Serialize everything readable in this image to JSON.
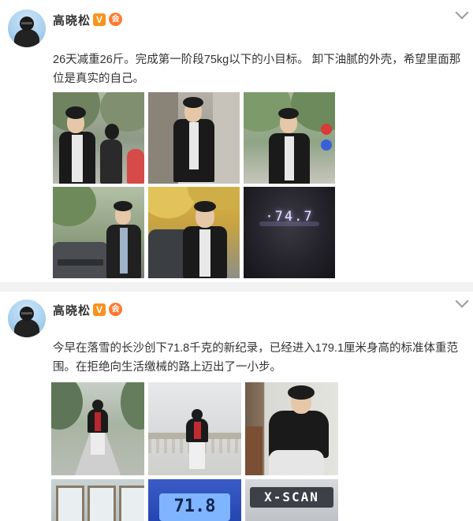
{
  "posts": [
    {
      "username": "高晓松",
      "badges": {
        "verified": "V",
        "member": "会"
      },
      "text": "26天减重26斤。完成第一阶段75kg以下的小目标。 卸下油腻的外壳，希望里面那位是真实的自己。",
      "photos": [
        {
          "name": "photo-park-walk",
          "kind": "park"
        },
        {
          "name": "photo-doorway",
          "kind": "door"
        },
        {
          "name": "photo-street-sign",
          "kind": "street"
        },
        {
          "name": "photo-car-trees",
          "kind": "car"
        },
        {
          "name": "photo-yellow-trees",
          "kind": "yellow"
        },
        {
          "name": "photo-scale-display",
          "kind": "scale",
          "reading": "·74.7"
        }
      ]
    },
    {
      "username": "高晓松",
      "badges": {
        "verified": "V",
        "member": "会"
      },
      "text": "今早在落雪的长沙创下71.8千克的新纪录，已经进入179.1厘米身高的标准体重范围。在拒绝向生活缴械的路上迈出了一小步。",
      "photos": [
        {
          "name": "photo-snow-path",
          "kind": "snowpath"
        },
        {
          "name": "photo-snow-bridge",
          "kind": "bridge"
        },
        {
          "name": "photo-seated-chair",
          "kind": "seated"
        },
        {
          "name": "photo-window-room",
          "kind": "window"
        },
        {
          "name": "photo-blue-scale",
          "kind": "bluescale",
          "reading": "71.8"
        },
        {
          "name": "photo-x-scan",
          "kind": "xscan",
          "label": "X-SCAN"
        }
      ]
    }
  ],
  "icons": {
    "chevron": "chevron-down-icon",
    "avatar": "avatar"
  },
  "colors": {
    "verified": "#f7931e",
    "member": "#ff7a2f",
    "separator": "#f2f2f2",
    "text": "#333333"
  }
}
